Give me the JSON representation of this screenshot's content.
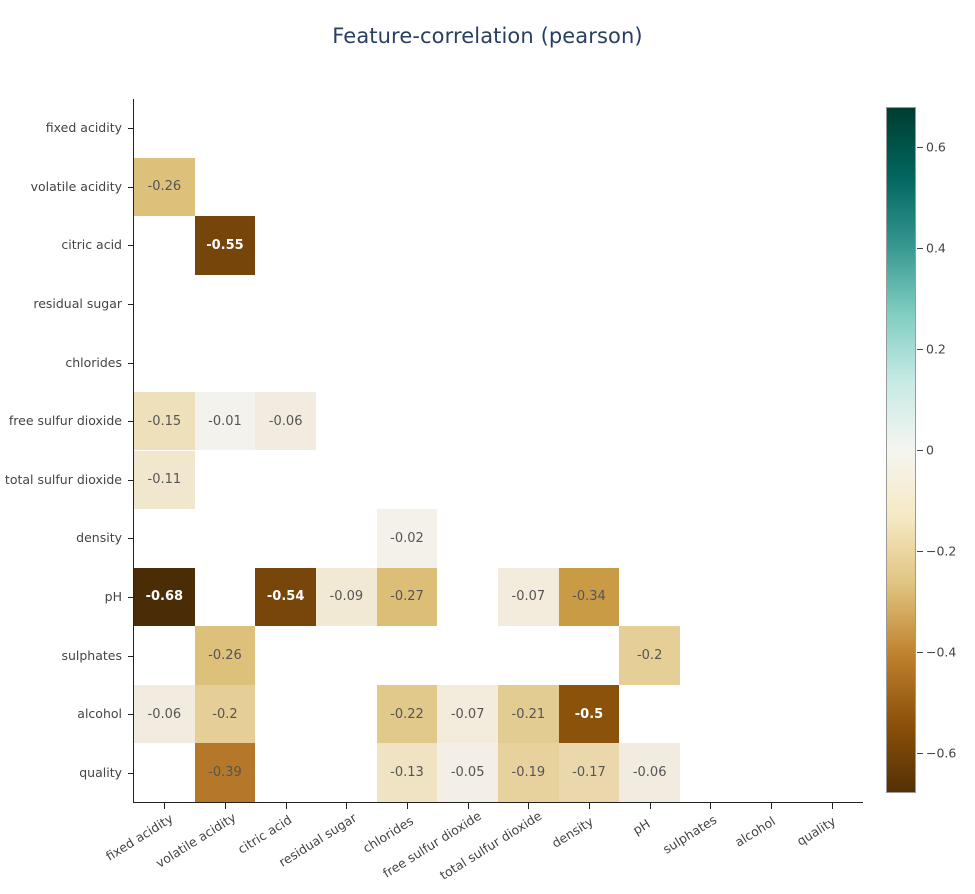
{
  "chart_data": {
    "type": "heatmap",
    "title": "Feature-correlation (pearson)",
    "xlabel": "",
    "ylabel": "",
    "grid": false,
    "legend_position": "right",
    "colorscale_name": "BrBG",
    "colorbar": {
      "ticks": [
        "0.6",
        "0.4",
        "0.2",
        "0",
        "−0.2",
        "−0.4",
        "−0.6"
      ],
      "tick_values": [
        0.6,
        0.4,
        0.2,
        0,
        -0.2,
        -0.4,
        -0.6
      ],
      "zmin": -0.68,
      "zmax": 0.68,
      "stops": [
        {
          "t": 0.0,
          "color": "#543005"
        },
        {
          "t": 0.1,
          "color": "#8c510a"
        },
        {
          "t": 0.2,
          "color": "#bf812d"
        },
        {
          "t": 0.3,
          "color": "#dfc27d"
        },
        {
          "t": 0.4,
          "color": "#f6e8c3"
        },
        {
          "t": 0.5,
          "color": "#f5f5f0"
        },
        {
          "t": 0.6,
          "color": "#c7eae5"
        },
        {
          "t": 0.7,
          "color": "#80cdc1"
        },
        {
          "t": 0.8,
          "color": "#35978f"
        },
        {
          "t": 0.9,
          "color": "#01665e"
        },
        {
          "t": 1.0,
          "color": "#003c30"
        }
      ]
    },
    "x": [
      "fixed acidity",
      "volatile acidity",
      "citric acid",
      "residual sugar",
      "chlorides",
      "free sulfur dioxide",
      "total sulfur dioxide",
      "density",
      "pH",
      "sulphates",
      "alcohol",
      "quality"
    ],
    "y": [
      "fixed acidity",
      "volatile acidity",
      "citric acid",
      "residual sugar",
      "chlorides",
      "free sulfur dioxide",
      "total sulfur dioxide",
      "density",
      "pH",
      "sulphates",
      "alcohol",
      "quality"
    ],
    "cells": [
      {
        "row": 1,
        "col": 0,
        "value": -0.26,
        "label": "-0.26",
        "color": "#ddc07a",
        "bold": false
      },
      {
        "row": 2,
        "col": 1,
        "value": -0.55,
        "label": "-0.55",
        "color": "#76450a",
        "bold": true
      },
      {
        "row": 5,
        "col": 0,
        "value": -0.15,
        "label": "-0.15",
        "color": "#eee0bb",
        "bold": false
      },
      {
        "row": 5,
        "col": 1,
        "value": -0.01,
        "label": "-0.01",
        "color": "#f4f2ed",
        "bold": false
      },
      {
        "row": 5,
        "col": 2,
        "value": -0.06,
        "label": "-0.06",
        "color": "#f2ece0",
        "bold": false
      },
      {
        "row": 6,
        "col": 0,
        "value": -0.11,
        "label": "-0.11",
        "color": "#f1e7cf",
        "bold": false
      },
      {
        "row": 7,
        "col": 4,
        "value": -0.02,
        "label": "-0.02",
        "color": "#f4f1ea",
        "bold": false
      },
      {
        "row": 8,
        "col": 0,
        "value": -0.68,
        "label": "-0.68",
        "color": "#4a2c06",
        "bold": true
      },
      {
        "row": 8,
        "col": 2,
        "value": -0.54,
        "label": "-0.54",
        "color": "#78460a",
        "bold": true
      },
      {
        "row": 8,
        "col": 3,
        "value": -0.09,
        "label": "-0.09",
        "color": "#f2e9d5",
        "bold": false
      },
      {
        "row": 8,
        "col": 4,
        "value": -0.27,
        "label": "-0.27",
        "color": "#dcbe76",
        "bold": false
      },
      {
        "row": 8,
        "col": 6,
        "value": -0.07,
        "label": "-0.07",
        "color": "#f3ebdc",
        "bold": false
      },
      {
        "row": 8,
        "col": 7,
        "value": -0.34,
        "label": "-0.34",
        "color": "#ca9b45",
        "bold": false
      },
      {
        "row": 9,
        "col": 1,
        "value": -0.26,
        "label": "-0.26",
        "color": "#ddc07a",
        "bold": false
      },
      {
        "row": 9,
        "col": 8,
        "value": -0.2,
        "label": "-0.2",
        "color": "#e5cf96",
        "bold": false
      },
      {
        "row": 10,
        "col": 0,
        "value": -0.06,
        "label": "-0.06",
        "color": "#f2ece0",
        "bold": false
      },
      {
        "row": 10,
        "col": 1,
        "value": -0.2,
        "label": "-0.2",
        "color": "#e5cf96",
        "bold": false
      },
      {
        "row": 10,
        "col": 4,
        "value": -0.22,
        "label": "-0.22",
        "color": "#e1c98c",
        "bold": false
      },
      {
        "row": 10,
        "col": 5,
        "value": -0.07,
        "label": "-0.07",
        "color": "#f3ebdc",
        "bold": false
      },
      {
        "row": 10,
        "col": 6,
        "value": -0.21,
        "label": "-0.21",
        "color": "#e3cc91",
        "bold": false
      },
      {
        "row": 10,
        "col": 7,
        "value": -0.5,
        "label": "-0.5",
        "color": "#8a520b",
        "bold": true
      },
      {
        "row": 11,
        "col": 1,
        "value": -0.39,
        "label": "-0.39",
        "color": "#b5782a",
        "bold": false
      },
      {
        "row": 11,
        "col": 4,
        "value": -0.13,
        "label": "-0.13",
        "color": "#efe3c4",
        "bold": false
      },
      {
        "row": 11,
        "col": 5,
        "value": -0.05,
        "label": "-0.05",
        "color": "#f3eee6",
        "bold": false
      },
      {
        "row": 11,
        "col": 6,
        "value": -0.19,
        "label": "-0.19",
        "color": "#e7d29d",
        "bold": false
      },
      {
        "row": 11,
        "col": 7,
        "value": -0.17,
        "label": "-0.17",
        "color": "#ead8ac",
        "bold": false
      },
      {
        "row": 11,
        "col": 8,
        "value": -0.06,
        "label": "-0.06",
        "color": "#f2ece0",
        "bold": false
      }
    ]
  }
}
